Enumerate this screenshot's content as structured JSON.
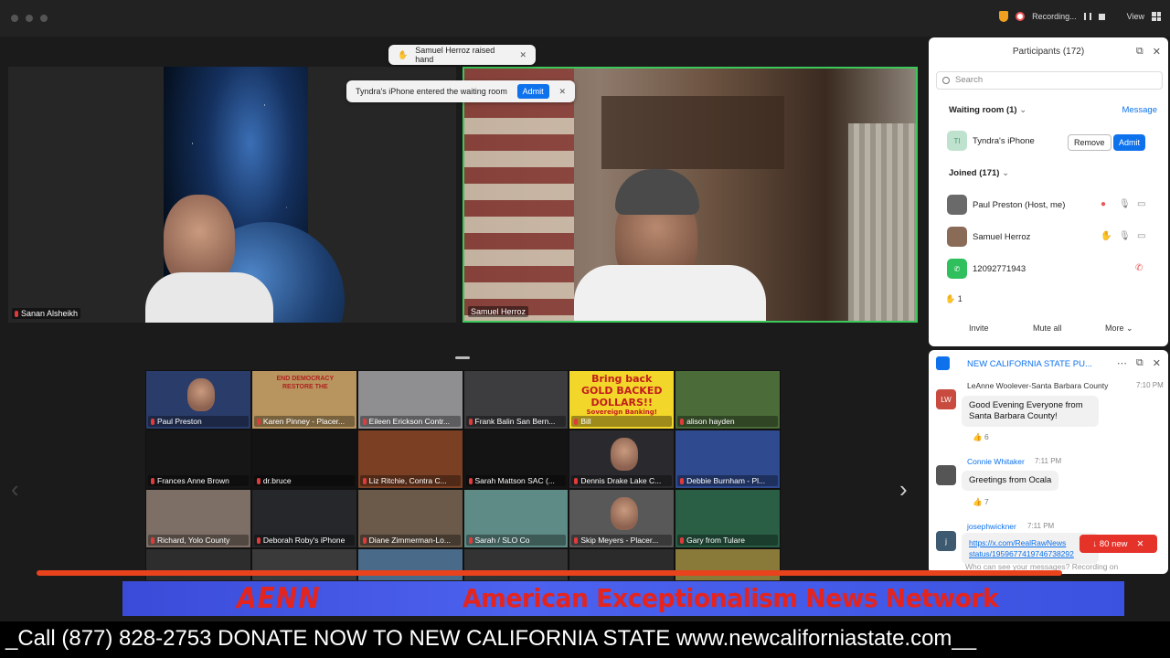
{
  "top_bar": {
    "recording_label": "Recording...",
    "view_label": "View"
  },
  "toasts": {
    "raised_hand": "Samuel Herroz raised hand",
    "waiting": "Tyndra's iPhone entered the waiting room",
    "admit_label": "Admit"
  },
  "main_videos": [
    {
      "name": "Sanan Alsheikh"
    },
    {
      "name": "Samuel Herroz"
    }
  ],
  "gallery": [
    {
      "name": "Paul Preston",
      "bg": "#2a3d6a"
    },
    {
      "name": "Karen Pinney - Placer...",
      "bg": "#b8955e"
    },
    {
      "name": "Eileen Erickson Contr...",
      "bg": "#8f8f92"
    },
    {
      "name": "Frank Balin  San Bern...",
      "bg": "#3d3d40"
    },
    {
      "name": "Bill",
      "bg": "#f3d62a"
    },
    {
      "name": "alison hayden",
      "bg": "#4b6b38"
    },
    {
      "name": "Frances Anne Brown",
      "bg": "#161616"
    },
    {
      "name": "dr.bruce",
      "bg": "#131313"
    },
    {
      "name": "Liz Ritchie, Contra C...",
      "bg": "#7b4024"
    },
    {
      "name": "Sarah Mattson SAC (...",
      "bg": "#141414"
    },
    {
      "name": "Dennis Drake  Lake C...",
      "bg": "#2a2a2e"
    },
    {
      "name": "Debbie Burnham - Pl...",
      "bg": "#2f4a8f"
    },
    {
      "name": "Richard, Yolo County",
      "bg": "#7e6f66"
    },
    {
      "name": "Deborah Roby's iPhone",
      "bg": "#26272a"
    },
    {
      "name": "Diane Zimmerman-Lo...",
      "bg": "#6b5a49"
    },
    {
      "name": "Sarah / SLO Co",
      "bg": "#5e8b86"
    },
    {
      "name": "Skip Meyers - Placer...",
      "bg": "#585858"
    },
    {
      "name": "Gary from Tulare",
      "bg": "#2a5f45"
    }
  ],
  "gallery_images": {
    "bill_sign_line1": "Bring back",
    "bill_sign_line2": "GOLD BACKED",
    "bill_sign_line3": "DOLLARS!!",
    "bill_sign_line4": "Sovereign Banking!",
    "karen_sign": "END DEMOCRACY RESTORE THE"
  },
  "participants": {
    "title": "Participants (172)",
    "search_placeholder": "Search",
    "waiting_room": "Waiting room (1)",
    "message_label": "Message",
    "waiting_person": "Tyndra's iPhone",
    "waiting_initials": "TI",
    "remove_label": "Remove",
    "admit_label": "Admit",
    "joined": "Joined (171)",
    "rows": [
      {
        "name": "Paul Preston (Host, me)"
      },
      {
        "name": "Samuel Herroz"
      },
      {
        "name": "12092771943"
      }
    ],
    "hands_count": "1",
    "invite_label": "Invite",
    "mute_all_label": "Mute all",
    "more_label": "More"
  },
  "chat": {
    "title": "NEW CALIFORNIA STATE PU...",
    "messages": [
      {
        "name": "LeAnne Woolever-Santa Barbara County",
        "time": "7:10 PM",
        "initials": "LW",
        "text_line1": "Good Evening Everyone from",
        "text_line2": "Santa Barbara County!",
        "reactions": "6"
      },
      {
        "name": "Connie Whitaker",
        "time": "7:11 PM",
        "text_line1": "Greetings from Ocala",
        "reactions": "7"
      },
      {
        "name": "josephwickner",
        "time": "7:11 PM",
        "initials": "j",
        "link_line1": "https://x.com/RealRawNews",
        "link_line2": "status/1959677419746738292"
      }
    ],
    "new_count": "80 new",
    "notice": "Who can see your messages? Recording on"
  },
  "broadcast": {
    "logo": "AENN",
    "network": "American Exceptionalism News Network",
    "ticker": "_Call (877) 828-2753 DONATE NOW TO NEW CALIFORNIA STATE www.newcaliforniastate.com__"
  }
}
